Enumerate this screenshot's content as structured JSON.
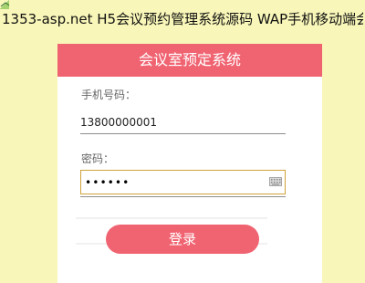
{
  "page": {
    "header": "1353-asp.net H5会议预约管理系统源码 WAP手机移动端会"
  },
  "login": {
    "title": "会议室预定系统",
    "phone_label": "手机号码：",
    "phone_value": "13800000001",
    "password_label": "密码：",
    "password_value": "••••••",
    "login_button": "登录"
  },
  "colors": {
    "background": "#f8f6b8",
    "accent": "#f06472",
    "focus_border": "#d0a23b"
  },
  "icons": {
    "corner_mark": "check-diamond-icon",
    "keyboard": "keyboard-icon"
  }
}
